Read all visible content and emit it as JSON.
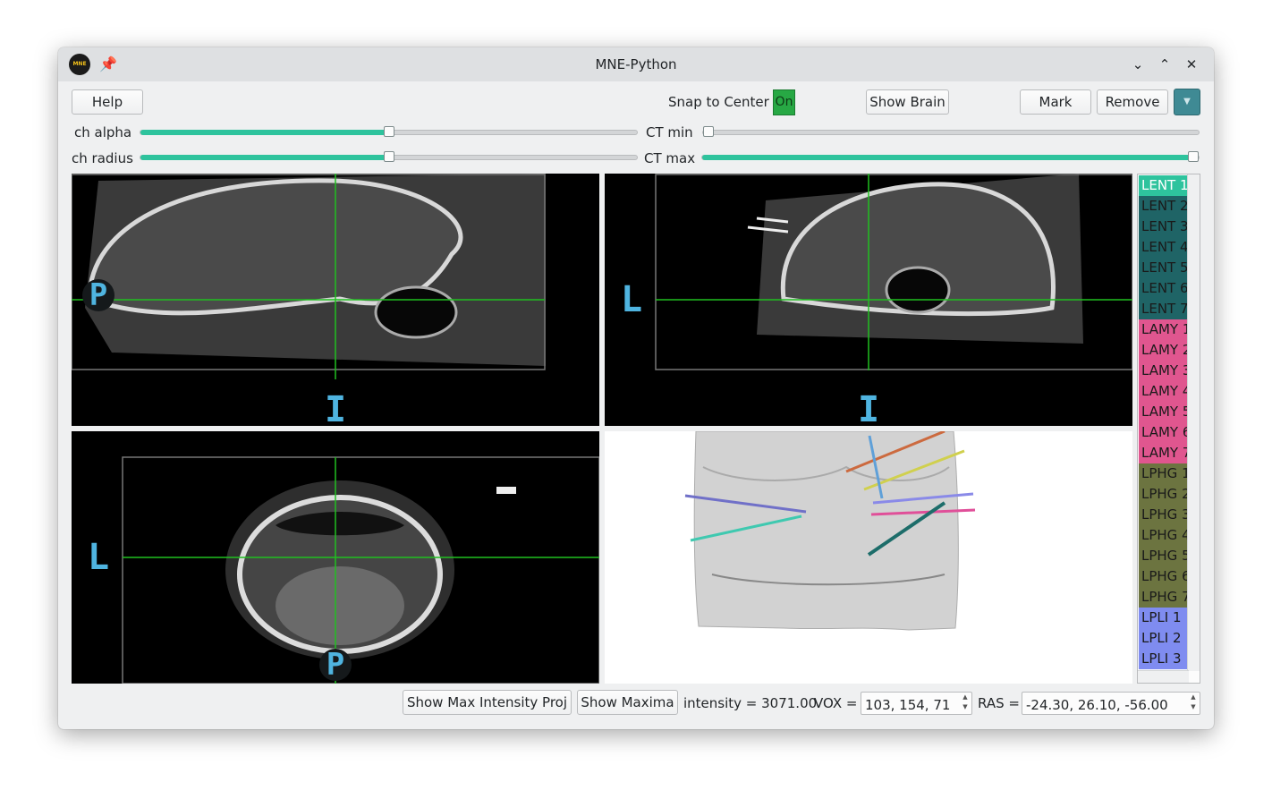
{
  "window": {
    "title": "MNE-Python",
    "logo_text": "MNE"
  },
  "titlebar": {
    "minimize": "⌄",
    "maximize": "⌃",
    "close": "✕"
  },
  "toolbar": {
    "help_label": "Help",
    "snap_label": "Snap to Center",
    "snap_value": "On",
    "show_brain_label": "Show Brain",
    "mark_label": "Mark",
    "remove_label": "Remove",
    "menu_color": "#3f8a94"
  },
  "sliders": {
    "ch_alpha": {
      "label": "ch alpha",
      "value_fraction": 0.5
    },
    "ch_radius": {
      "label": "ch radius",
      "value_fraction": 0.5
    },
    "ct_min": {
      "label": "CT min",
      "value_fraction": 0.0
    },
    "ct_max": {
      "label": "CT max",
      "value_fraction": 1.0
    }
  },
  "views": {
    "sagittal": {
      "left_label": "P",
      "bottom_label": "I"
    },
    "coronal": {
      "left_label": "L",
      "bottom_label": "I"
    },
    "axial": {
      "left_label": "L",
      "bottom_label": "P"
    }
  },
  "channels": [
    {
      "name": "LENT 1",
      "color": "#2ec39d",
      "selected": true
    },
    {
      "name": "LENT 2",
      "color": "#1f6466"
    },
    {
      "name": "LENT 3",
      "color": "#1f6466"
    },
    {
      "name": "LENT 4",
      "color": "#1f6466"
    },
    {
      "name": "LENT 5",
      "color": "#1f6466"
    },
    {
      "name": "LENT 6",
      "color": "#1f6466"
    },
    {
      "name": "LENT 7",
      "color": "#1f6466"
    },
    {
      "name": "LAMY 1",
      "color": "#e0568f"
    },
    {
      "name": "LAMY 2",
      "color": "#e0568f"
    },
    {
      "name": "LAMY 3",
      "color": "#e0568f"
    },
    {
      "name": "LAMY 4",
      "color": "#e0568f"
    },
    {
      "name": "LAMY 5",
      "color": "#e0568f"
    },
    {
      "name": "LAMY 6",
      "color": "#e0568f"
    },
    {
      "name": "LAMY 7",
      "color": "#e0568f"
    },
    {
      "name": "LPHG 1",
      "color": "#6c7440"
    },
    {
      "name": "LPHG 2",
      "color": "#6c7440"
    },
    {
      "name": "LPHG 3",
      "color": "#6c7440"
    },
    {
      "name": "LPHG 4",
      "color": "#6c7440"
    },
    {
      "name": "LPHG 5",
      "color": "#6c7440"
    },
    {
      "name": "LPHG 6",
      "color": "#6c7440"
    },
    {
      "name": "LPHG 7",
      "color": "#6c7440"
    },
    {
      "name": "LPLI 1",
      "color": "#7f8cf0"
    },
    {
      "name": "LPLI 2",
      "color": "#7f8cf0"
    },
    {
      "name": "LPLI 3",
      "color": "#7f8cf0"
    }
  ],
  "bottom": {
    "show_mip_label": "Show Max Intensity Proj",
    "show_maxima_label": "Show Maxima",
    "intensity_text": "intensity = 3071.00",
    "vox_label": "VOX =",
    "vox_value": "103, 154,  71",
    "ras_label": "RAS =",
    "ras_value": "-24.30, 26.10, -56.00"
  },
  "icons": {
    "logo": "mne-logo-icon",
    "pin": "pin-icon",
    "minimize": "chevron-down-icon",
    "maximize": "chevron-up-icon",
    "close": "close-icon",
    "menu": "dropdown-arrow-icon"
  }
}
